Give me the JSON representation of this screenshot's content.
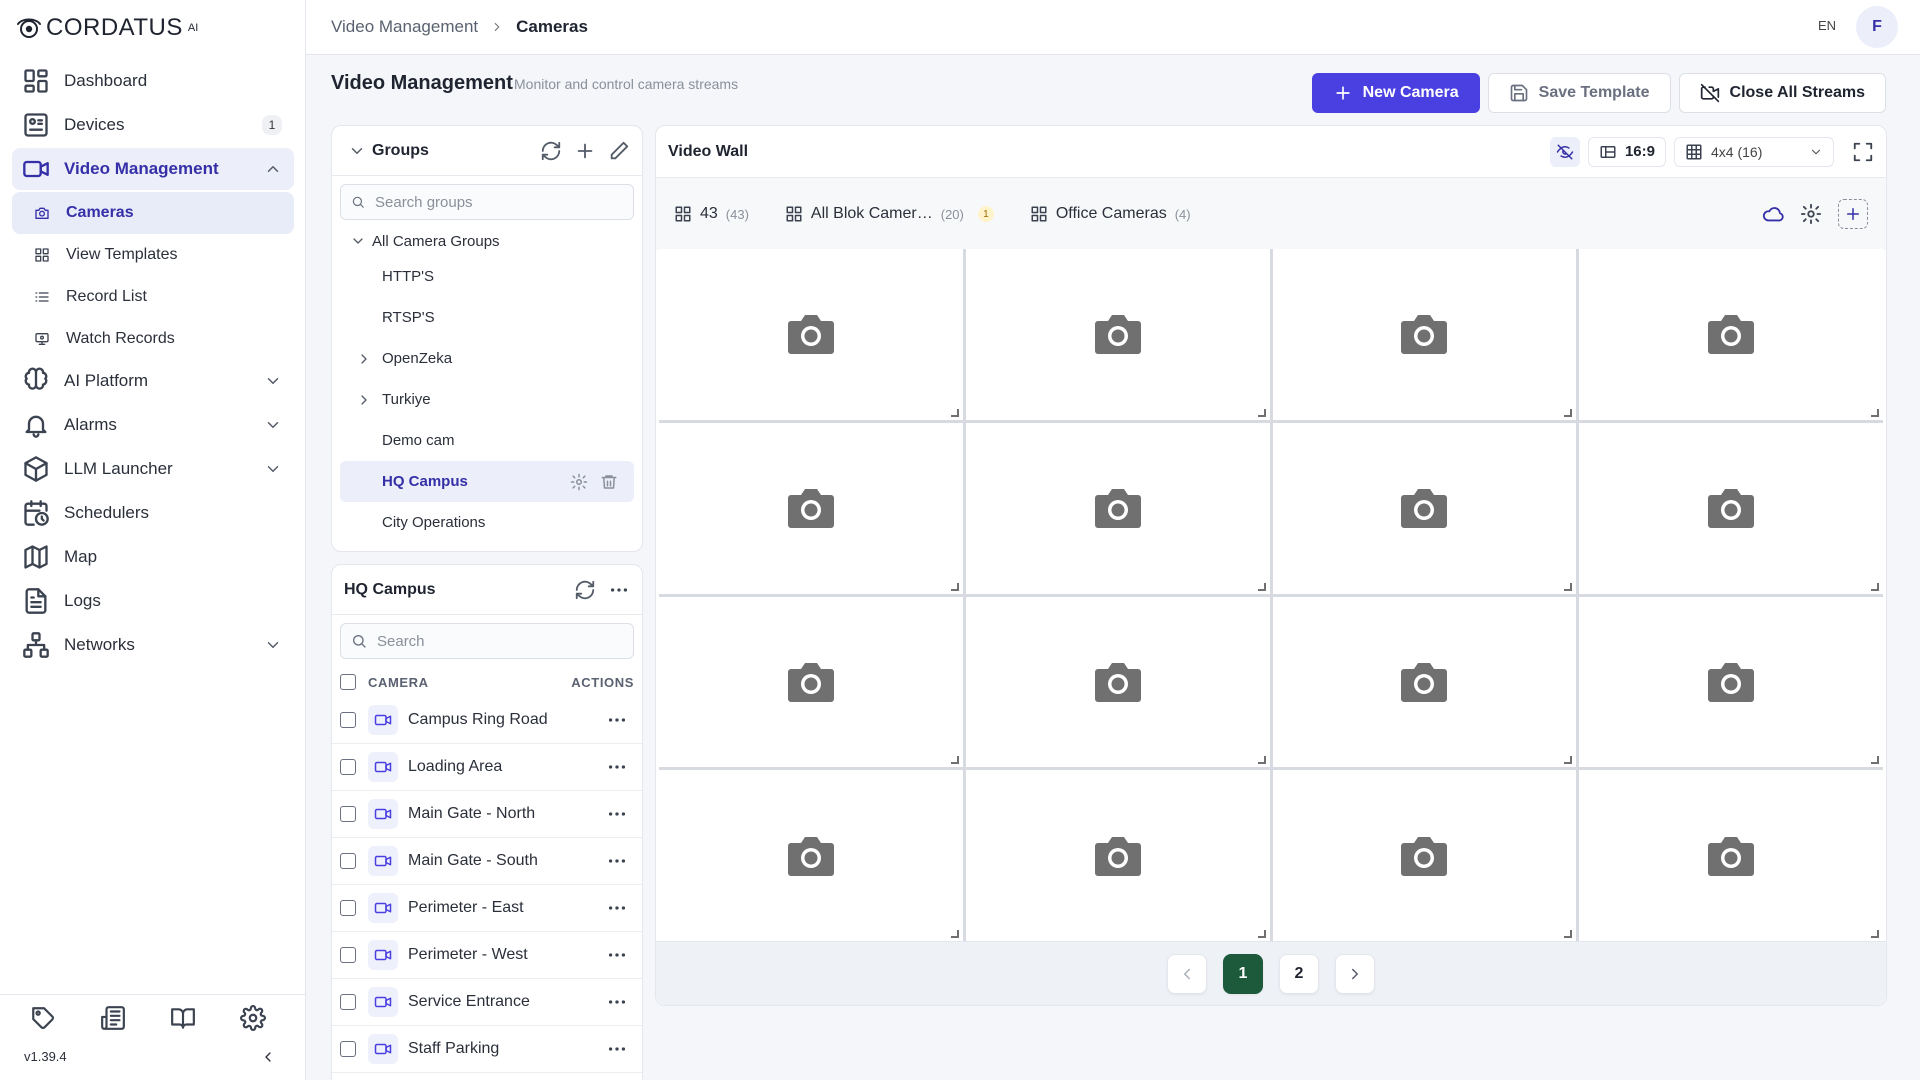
{
  "brand": {
    "name": "CORDATUS",
    "suffix": "AI"
  },
  "sidebar": {
    "items": [
      {
        "label": "Dashboard",
        "icon": "dashboard-icon"
      },
      {
        "label": "Devices",
        "icon": "devices-icon",
        "badge": "1"
      },
      {
        "label": "Video Management",
        "icon": "video-icon",
        "expanded": true,
        "children": [
          {
            "label": "Cameras",
            "icon": "camera-icon",
            "active": true
          },
          {
            "label": "View Templates",
            "icon": "templates-icon"
          },
          {
            "label": "Record List",
            "icon": "list-icon"
          },
          {
            "label": "Watch Records",
            "icon": "monitor-icon"
          }
        ]
      },
      {
        "label": "AI Platform",
        "icon": "brain-icon"
      },
      {
        "label": "Alarms",
        "icon": "bell-icon"
      },
      {
        "label": "LLM Launcher",
        "icon": "cube-icon"
      },
      {
        "label": "Schedulers",
        "icon": "calendar-clock-icon"
      },
      {
        "label": "Map",
        "icon": "map-icon"
      },
      {
        "label": "Logs",
        "icon": "file-text-icon"
      },
      {
        "label": "Networks",
        "icon": "network-icon"
      }
    ],
    "version": "v1.39.4"
  },
  "header": {
    "breadcrumb": [
      "Video Management",
      "Cameras"
    ],
    "language": "EN",
    "avatar_initial": "F"
  },
  "page": {
    "title": "Video Management",
    "subtitle": "Monitor and control camera streams",
    "actions": {
      "new_camera": "New Camera",
      "save_template": "Save Template",
      "close_streams": "Close All Streams"
    }
  },
  "groups": {
    "title": "Groups",
    "search_placeholder": "Search groups",
    "root": "All Camera Groups",
    "items": [
      {
        "label": "HTTP'S",
        "expandable": false
      },
      {
        "label": "RTSP'S",
        "expandable": false
      },
      {
        "label": "OpenZeka",
        "expandable": true
      },
      {
        "label": "Turkiye",
        "expandable": true
      },
      {
        "label": "Demo cam",
        "expandable": false
      },
      {
        "label": "HQ Campus",
        "expandable": false,
        "selected": true
      },
      {
        "label": "City Operations",
        "expandable": false
      }
    ]
  },
  "camera_list": {
    "title": "HQ Campus",
    "search_placeholder": "Search",
    "col_camera": "CAMERA",
    "col_actions": "ACTIONS",
    "rows": [
      "Campus Ring Road",
      "Loading Area",
      "Main Gate - North",
      "Main Gate - South",
      "Perimeter - East",
      "Perimeter - West",
      "Service Entrance",
      "Staff Parking"
    ]
  },
  "video_wall": {
    "title": "Video Wall",
    "ratio": "16:9",
    "layout": "4x4 (16)",
    "tabs": [
      {
        "label": "43",
        "count": "(43)"
      },
      {
        "label": "All Blok Camer…",
        "count": "(20)",
        "warning": "1"
      },
      {
        "label": "Office Cameras",
        "count": "(4)"
      }
    ],
    "tiles": 16,
    "pages": [
      "1",
      "2"
    ],
    "current_page": "1"
  }
}
